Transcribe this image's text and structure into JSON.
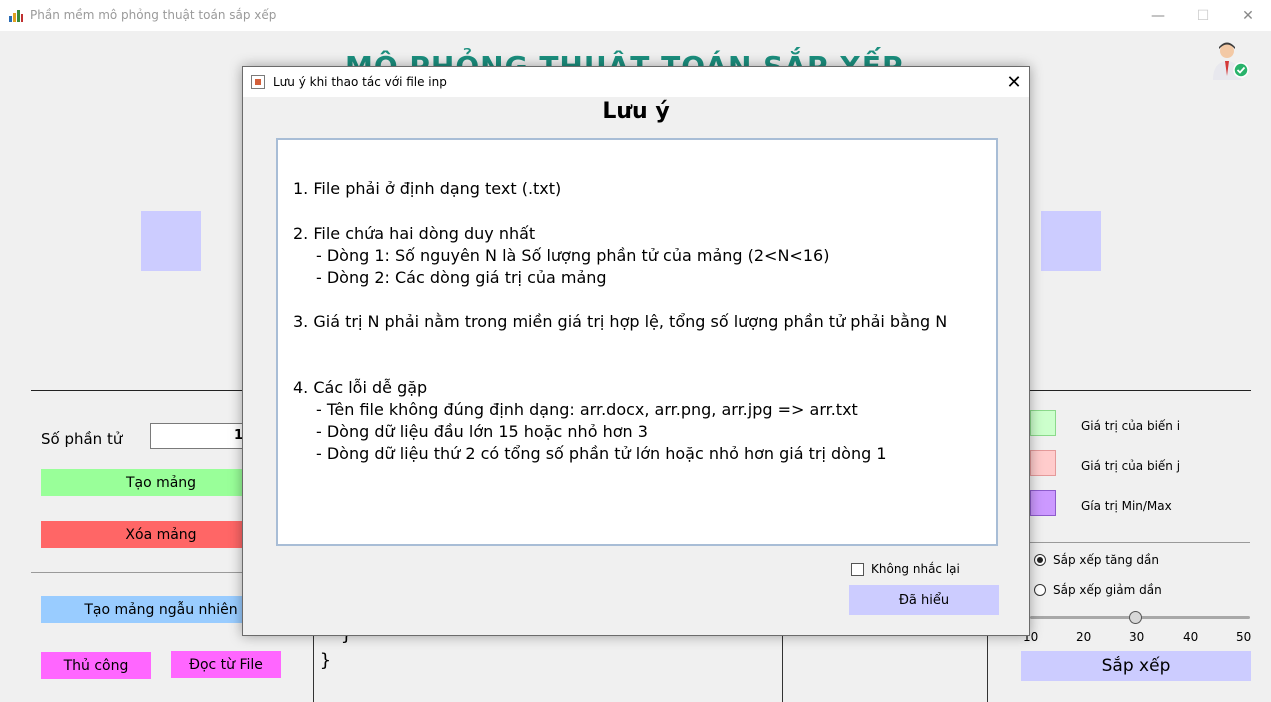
{
  "window": {
    "title": "Phần mềm mô phỏng thuật toán sắp xếp",
    "minimize_glyph": "—",
    "maximize_glyph": "☐",
    "close_glyph": "✕"
  },
  "app": {
    "heading": "MÔ PHỎNG THUẬT TOÁN SẮP XẾP",
    "count_label": "Số phần tử",
    "count_value": "1",
    "buttons": {
      "create_array": "Tạo mảng",
      "delete_array": "Xóa mảng",
      "random_array": "Tạo mảng ngẫu nhiên",
      "manual": "Thủ công",
      "read_file": "Đọc từ File",
      "sort": "Sắp xếp"
    },
    "legend": [
      {
        "label": "Giá trị của biến i",
        "color": "#ccffcc"
      },
      {
        "label": "Giá trị của biến j",
        "color": "#ffcccc"
      },
      {
        "label": "Gía trị Min/Max",
        "color": "#cc99ff"
      }
    ],
    "sort_order": {
      "ascending": "Sắp xếp tăng dần",
      "descending": "Sắp xếp giảm dần",
      "selected": "ascending"
    },
    "speed_slider": {
      "ticks": [
        "10",
        "20",
        "30",
        "40",
        "50"
      ],
      "value": 30,
      "min": 10,
      "max": 50
    },
    "code_lines": [
      "}",
      "}"
    ]
  },
  "dialog": {
    "title": "Lưu ý khi thao tác với file inp",
    "close_glyph": "✕",
    "heading": "Lưu ý",
    "notes": [
      "1.  File phải ở định dạng text (.txt)",
      "2.  File chứa hai dòng duy nhất",
      "- Dòng 1: Số nguyên N là Số lượng phần tử của mảng (2<N<16)",
      "- Dòng 2: Các dòng giá trị của mảng",
      "3.  Giá trị N phải nằm trong miền giá trị hợp lệ, tổng số lượng phần tử phải bằng N",
      "4.  Các lỗi dễ gặp",
      "- Tên file không đúng định dạng: arr.docx, arr.png, arr.jpg => arr.txt",
      "- Dòng dữ liệu đầu lớn 15 hoặc nhỏ hơn 3",
      "- Dòng dữ liệu thứ 2 có tổng số phần tử lớn hoặc nhỏ hơn giá trị dòng 1"
    ],
    "dont_remind_label": "Không nhắc lại",
    "dont_remind_checked": false,
    "ok_label": "Đã hiểu"
  },
  "colors": {
    "heading_teal": "#1b8f7e",
    "array_box": "#ccccff",
    "btn_green": "#99ff99",
    "btn_red": "#ff6666",
    "btn_blue": "#99ccff",
    "btn_pink": "#ff66ff",
    "btn_lavender": "#ccccff"
  }
}
